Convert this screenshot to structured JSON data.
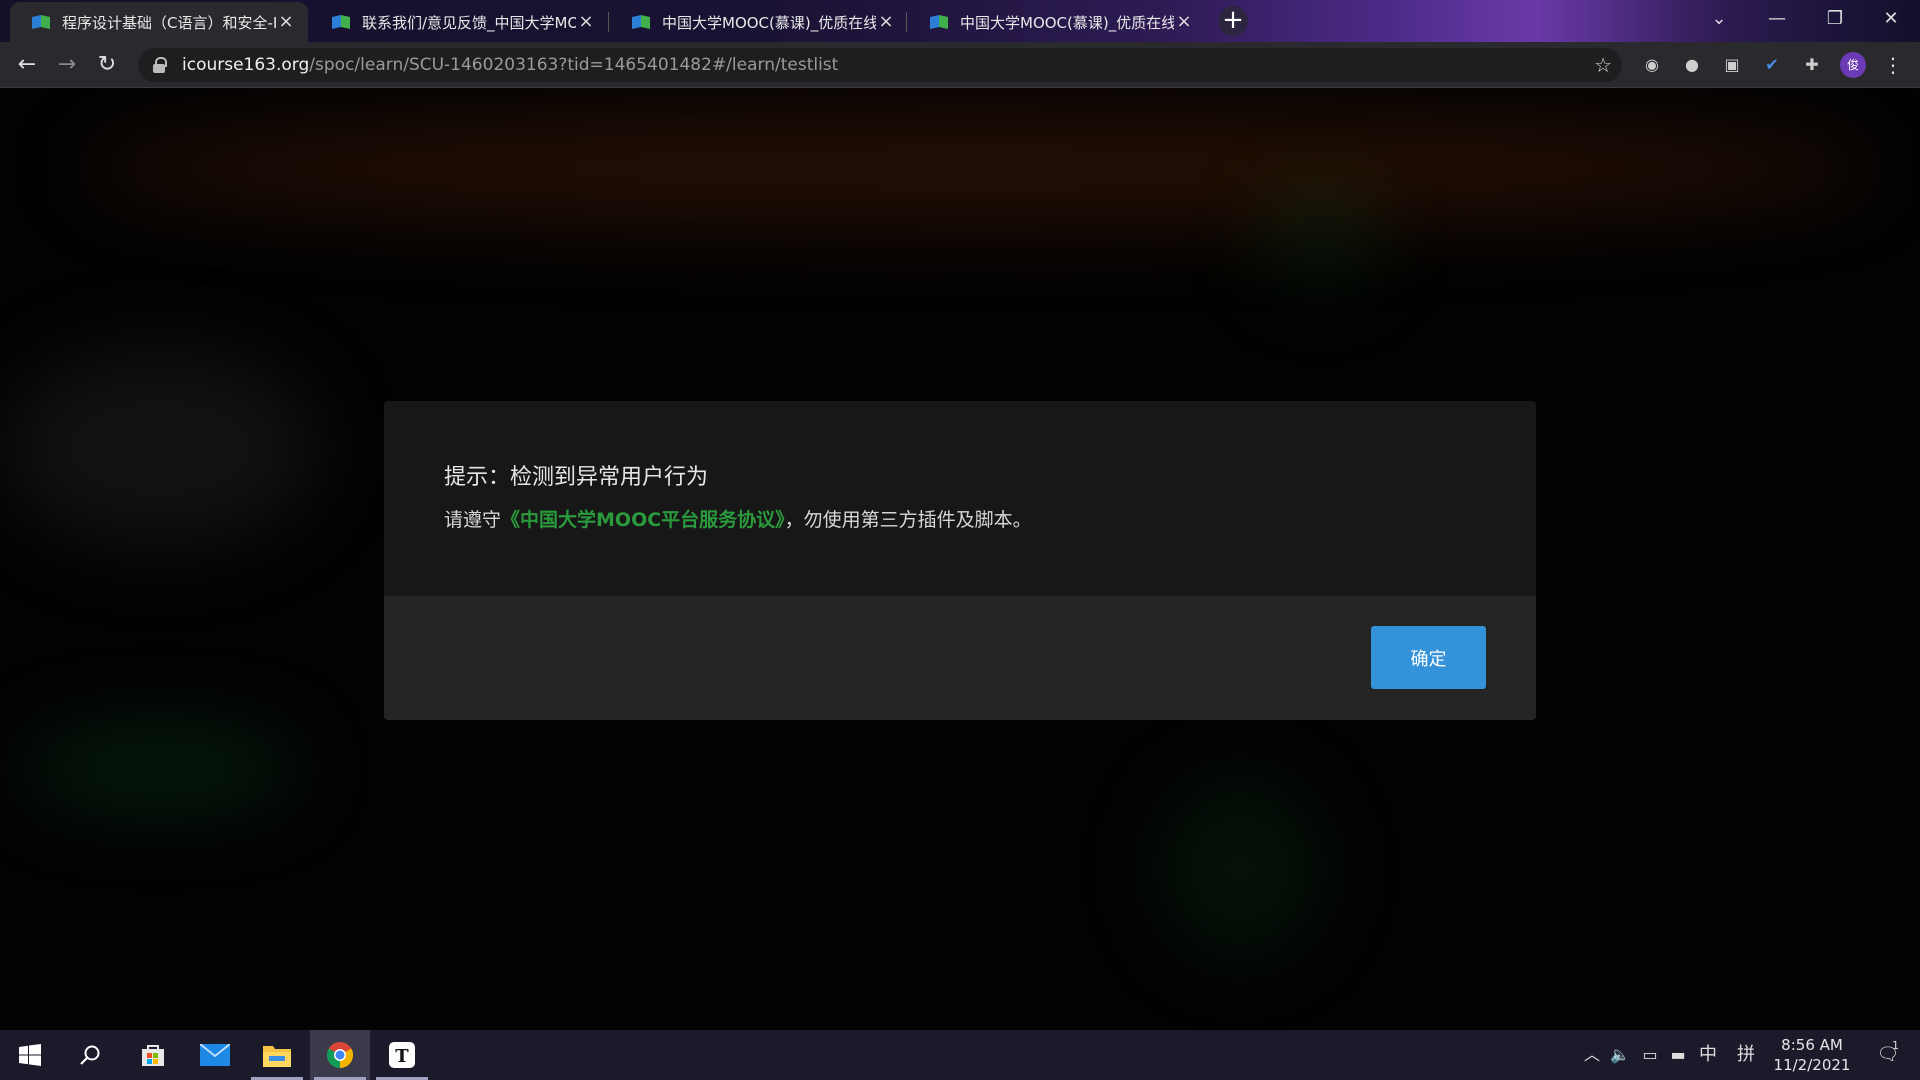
{
  "browser": {
    "tabs": [
      {
        "title": "程序设计基础（C语言）和安全-I",
        "active": true
      },
      {
        "title": "联系我们/意见反馈_中国大学MO",
        "active": false
      },
      {
        "title": "中国大学MOOC(慕课)_优质在线",
        "active": false
      },
      {
        "title": "中国大学MOOC(慕课)_优质在线",
        "active": false
      }
    ],
    "url_host": "icourse163.org",
    "url_path": "/spoc/learn/SCU-1460203163?tid=1465401482#/learn/testlist",
    "avatar_initial": "俊",
    "extensions": [
      "chrome-ext-icon",
      "circle-ext-icon",
      "mask-ext-icon",
      "check-ext-icon",
      "puzzle-icon"
    ]
  },
  "dialog": {
    "title": "提示：检测到异常用户行为",
    "message_prefix": "请遵守",
    "agreement_link": "《中国大学MOOC平台服务协议》",
    "message_suffix": "，勿使用第三方插件及脚本。",
    "ok_label": "确定",
    "link_color": "#2a9a3c",
    "button_color": "#3392d8"
  },
  "taskbar": {
    "apps": [
      "windows-start-icon",
      "search-icon",
      "store-icon",
      "mail-icon",
      "file-explorer-icon",
      "chrome-icon",
      "typora-icon"
    ],
    "ime": "中",
    "ime_mode": "拼",
    "time": "8:56 AM",
    "date": "11/2/2021",
    "notification_count": "1"
  }
}
